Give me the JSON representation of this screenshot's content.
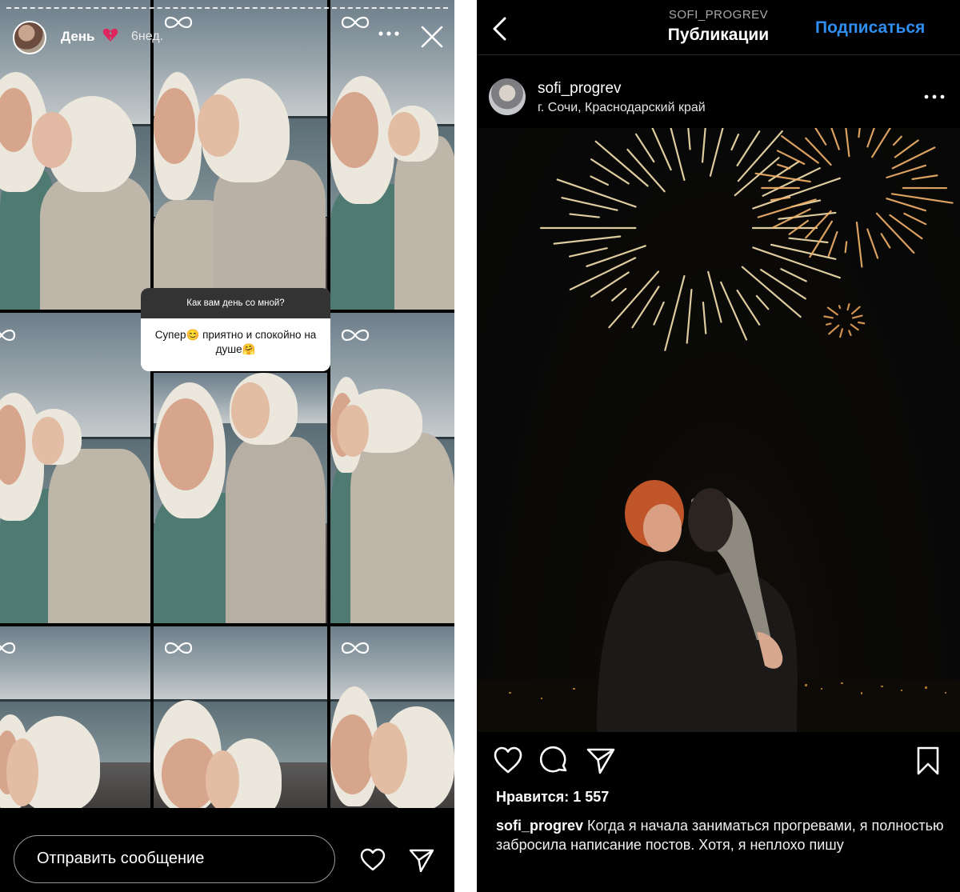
{
  "story": {
    "title": "День",
    "time_ago": "6нед.",
    "question": {
      "prompt": "Как вам день со мной?",
      "answer": "Супер😊 приятно и спокойно на душе🤗"
    },
    "message_placeholder": "Отправить сообщение",
    "icons": [
      "avatar",
      "broken-heart-icon",
      "more-icon",
      "close-icon",
      "infinity-icon",
      "heart-icon",
      "send-icon"
    ]
  },
  "post": {
    "nav": {
      "account": "SOFI_PROGREV",
      "title": "Публикации",
      "follow_label": "Подписаться"
    },
    "header": {
      "username": "sofi_progrev",
      "location": "г. Сочи, Краснодарский край"
    },
    "likes_label": "Нравится: 1 557",
    "caption": {
      "username": "sofi_progrev",
      "text": "Когда я начала заниматься прогревами, я полностью забросила написание постов. Хотя, я неплохо пишу"
    },
    "icons": [
      "back-chevron-icon",
      "more-icon",
      "heart-icon",
      "comment-icon",
      "share-icon",
      "bookmark-icon"
    ],
    "accent_color": "#2f8ef2"
  }
}
